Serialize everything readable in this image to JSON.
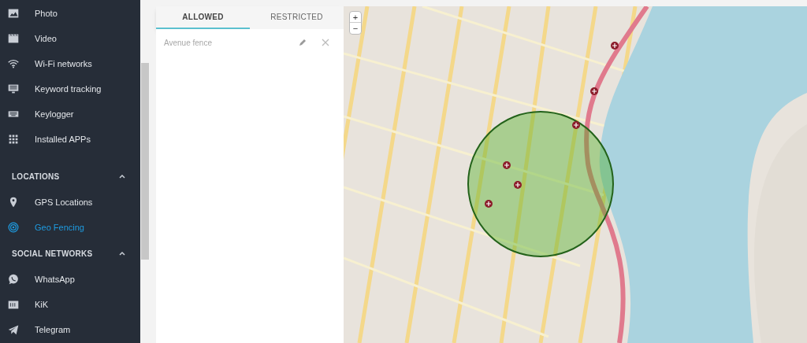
{
  "sidebar": {
    "items": [
      {
        "kind": "item",
        "label": "Photo",
        "selected": false
      },
      {
        "kind": "item",
        "label": "Video",
        "selected": false
      },
      {
        "kind": "item",
        "label": "Wi-Fi networks",
        "selected": false
      },
      {
        "kind": "item",
        "label": "Keyword tracking",
        "selected": false
      },
      {
        "kind": "item",
        "label": "Keylogger",
        "selected": false
      },
      {
        "kind": "item",
        "label": "Installed APPs",
        "selected": false
      },
      {
        "kind": "section",
        "label": "LOCATIONS",
        "expanded": true
      },
      {
        "kind": "item",
        "label": "GPS Locations",
        "selected": false
      },
      {
        "kind": "item",
        "label": "Geo Fencing",
        "selected": true
      },
      {
        "kind": "section",
        "label": "SOCIAL NETWORKS",
        "expanded": true
      },
      {
        "kind": "item",
        "label": "WhatsApp",
        "selected": false
      },
      {
        "kind": "item",
        "label": "KiK",
        "selected": false
      },
      {
        "kind": "item",
        "label": "Telegram",
        "selected": false
      }
    ]
  },
  "tabs": [
    {
      "label": "ALLOWED",
      "selected": true
    },
    {
      "label": "RESTRICTED",
      "selected": false
    }
  ],
  "fences": [
    {
      "name": "Avenue fence"
    }
  ],
  "map": {
    "zoom_in": "+",
    "zoom_out": "−"
  }
}
